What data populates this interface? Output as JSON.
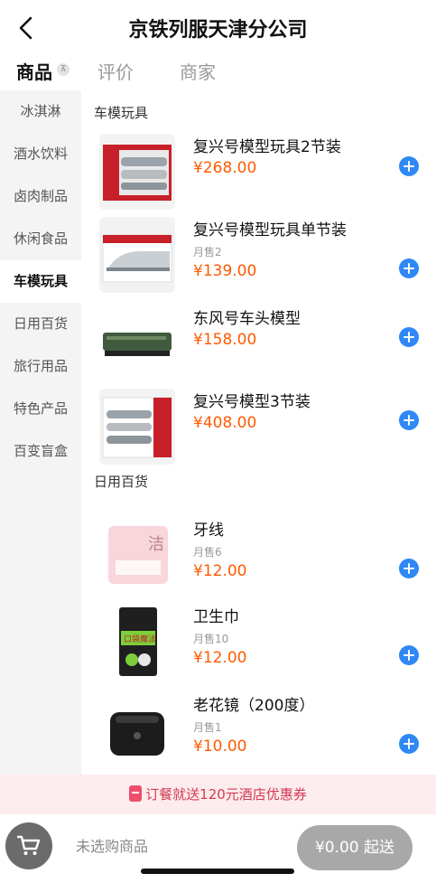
{
  "header": {
    "title": "京铁列服天津分公司",
    "back_icon": "chevron-left-icon"
  },
  "tabs": [
    {
      "label": "商品",
      "active": true
    },
    {
      "label": "评价",
      "active": false
    },
    {
      "label": "商家",
      "active": false
    }
  ],
  "sort_icon_glyph": "⊼",
  "sidebar": {
    "items": [
      {
        "label": "冰淇淋",
        "active": false
      },
      {
        "label": "酒水饮料",
        "active": false
      },
      {
        "label": "卤肉制品",
        "active": false
      },
      {
        "label": "休闲食品",
        "active": false
      },
      {
        "label": "车模玩具",
        "active": true
      },
      {
        "label": "日用百货",
        "active": false
      },
      {
        "label": "旅行用品",
        "active": false
      },
      {
        "label": "特色产品",
        "active": false
      },
      {
        "label": "百变盲盒",
        "active": false
      }
    ]
  },
  "sections": [
    {
      "title": "车模玩具",
      "products": [
        {
          "name": "复兴号模型玩具2节装",
          "sold": "",
          "price": "¥268.00"
        },
        {
          "name": "复兴号模型玩具单节装",
          "sold": "月售2",
          "price": "¥139.00"
        },
        {
          "name": "东风号车头模型",
          "sold": "",
          "price": "¥158.00"
        },
        {
          "name": "复兴号模型3节装",
          "sold": "",
          "price": "¥408.00"
        }
      ]
    },
    {
      "title": "日用百货",
      "products": [
        {
          "name": "牙线",
          "sold": "月售6",
          "price": "¥12.00"
        },
        {
          "name": "卫生巾",
          "sold": "月售10",
          "price": "¥12.00"
        },
        {
          "name": "老花镜（200度）",
          "sold": "月售1",
          "price": "¥10.00"
        }
      ]
    }
  ],
  "image_labels": {
    "floss": "洁",
    "pad": "口袋魔法"
  },
  "promo": {
    "text": "订餐就送120元酒店优惠券"
  },
  "bottom": {
    "cart_status": "未选购商品",
    "checkout": "¥0.00 起送"
  },
  "colors": {
    "price": "#ff5a00",
    "add_button": "#2f88f5",
    "promo_text": "#d23a52",
    "promo_bg": "#fdecee"
  }
}
